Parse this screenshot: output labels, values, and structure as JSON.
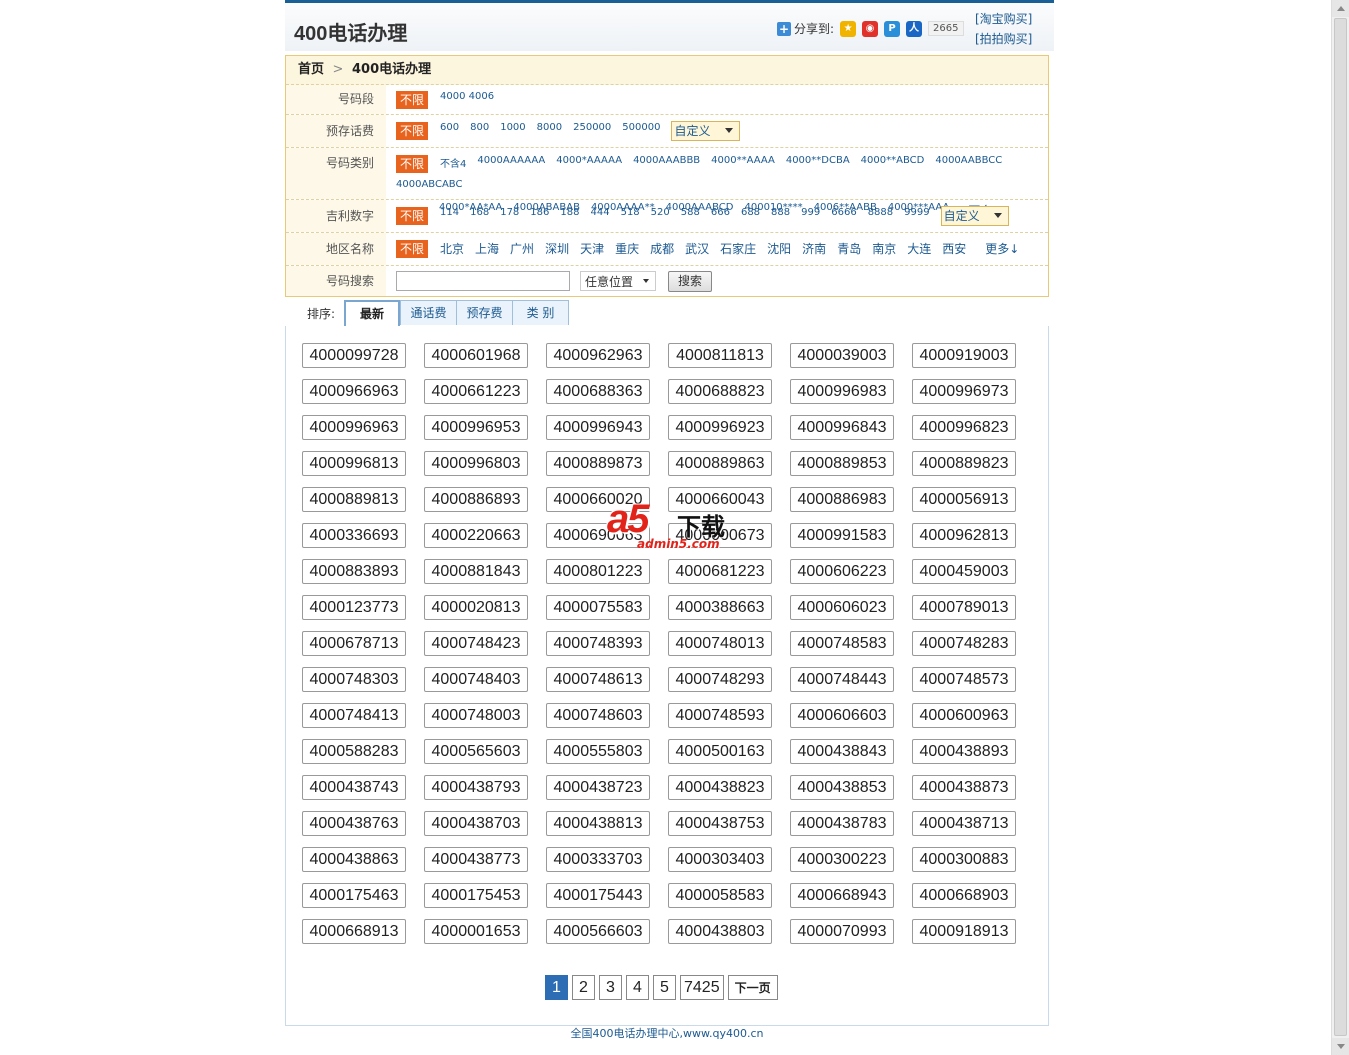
{
  "header": {
    "title": "400电话办理",
    "share_label": "分享到:",
    "share_count": "2665",
    "buy_links": [
      "[淘宝购买]",
      "[拍拍购买]"
    ]
  },
  "breadcrumb": {
    "home": "首页",
    "sep": ">",
    "current": "400电话办理"
  },
  "filters": {
    "no_limit": "不限",
    "segment": {
      "label": "号码段",
      "options": [
        "4000 4006"
      ]
    },
    "prepaid": {
      "label": "预存话费",
      "options": [
        "600",
        "800",
        "1000",
        "8000",
        "250000",
        "500000"
      ],
      "custom": "自定义"
    },
    "category": {
      "label": "号码类别",
      "options": [
        "不含4",
        "4000AAAAAA",
        "4000*AAAAA",
        "4000AAABBB",
        "4000**AAAA",
        "4000**DCBA",
        "4000**ABCD",
        "4000AABBCC",
        "4000ABCABC",
        "4000*AA*AA",
        "4000ABABAB",
        "4000AAAA**",
        "4000AAABCD",
        "400010****",
        "4006**AABB",
        "4000***AAA"
      ],
      "more": "更多↓"
    },
    "lucky": {
      "label": "吉利数字",
      "options": [
        "114",
        "168",
        "178",
        "186",
        "188",
        "444",
        "518",
        "520",
        "588",
        "666",
        "688",
        "888",
        "999",
        "6666",
        "8888",
        "9999"
      ],
      "custom": "自定义"
    },
    "region": {
      "label": "地区名称",
      "options": [
        "北京",
        "上海",
        "广州",
        "深圳",
        "天津",
        "重庆",
        "成都",
        "武汉",
        "石家庄",
        "沈阳",
        "济南",
        "青岛",
        "南京",
        "大连",
        "西安"
      ],
      "more": "更多↓"
    },
    "search": {
      "label": "号码搜索",
      "value": "",
      "position": "任意位置",
      "button": "搜索"
    }
  },
  "sort": {
    "label": "排序:",
    "tabs": [
      "最新",
      "通话费",
      "预存费",
      "类 别"
    ]
  },
  "numbers": [
    "4000099728",
    "4000601968",
    "4000962963",
    "4000811813",
    "4000039003",
    "4000919003",
    "4000966963",
    "4000661223",
    "4000688363",
    "4000688823",
    "4000996983",
    "4000996973",
    "4000996963",
    "4000996953",
    "4000996943",
    "4000996923",
    "4000996843",
    "4000996823",
    "4000996813",
    "4000996803",
    "4000889873",
    "4000889863",
    "4000889853",
    "4000889823",
    "4000889813",
    "4000886893",
    "4000660020",
    "4000660043",
    "4000886983",
    "4000056913",
    "4000336693",
    "4000220663",
    "4000690063",
    "4000000673",
    "4000991583",
    "4000962813",
    "4000883893",
    "4000881843",
    "4000801223",
    "4000681223",
    "4000606223",
    "4000459003",
    "4000123773",
    "4000020813",
    "4000075583",
    "4000388663",
    "4000606023",
    "4000789013",
    "4000678713",
    "4000748423",
    "4000748393",
    "4000748013",
    "4000748583",
    "4000748283",
    "4000748303",
    "4000748403",
    "4000748613",
    "4000748293",
    "4000748443",
    "4000748573",
    "4000748413",
    "4000748003",
    "4000748603",
    "4000748593",
    "4000606603",
    "4000600963",
    "4000588283",
    "4000565603",
    "4000555803",
    "4000500163",
    "4000438843",
    "4000438893",
    "4000438743",
    "4000438793",
    "4000438723",
    "4000438823",
    "4000438853",
    "4000438873",
    "4000438763",
    "4000438703",
    "4000438813",
    "4000438753",
    "4000438783",
    "4000438713",
    "4000438863",
    "4000438773",
    "4000333703",
    "4000303403",
    "4000300223",
    "4000300883",
    "4000175463",
    "4000175453",
    "4000175443",
    "4000058583",
    "4000668943",
    "4000668903",
    "4000668913",
    "4000001653",
    "4000566603",
    "4000438803",
    "4000070993",
    "4000918913"
  ],
  "pager": {
    "pages": [
      "1",
      "2",
      "3",
      "4",
      "5",
      "7425"
    ],
    "next": "下一页",
    "current": "1"
  },
  "footer": "全国400电话办理中心,www.qy400.cn",
  "watermark": {
    "logo": "a5",
    "text": "下载",
    "url": "admin5.com"
  }
}
